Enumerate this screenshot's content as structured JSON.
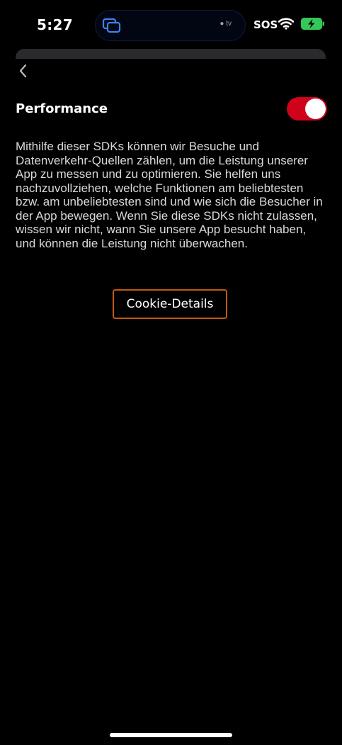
{
  "status_bar": {
    "time": "5:27",
    "island_label": "tv",
    "carrier": "SOS",
    "battery_color": "#34c759"
  },
  "header": {
    "back_icon": "chevron-left-icon"
  },
  "section": {
    "title": "Performance",
    "toggle_on": true,
    "toggle_color": "#d0021b",
    "description": "Mithilfe dieser SDKs können wir Besuche und Datenverkehr-Quellen zählen, um die Leistung unserer App zu messen und zu optimieren. Sie helfen uns nachzuvollziehen, welche Funktionen am beliebtesten bzw. am unbeliebtesten sind und wie sich die Besucher in der App bewegen. Wenn Sie diese SDKs nicht zulassen, wissen wir nicht, wann Sie unsere App besucht haben, und können die Leistung nicht überwachen."
  },
  "cookie_button": {
    "label": "Cookie-Details",
    "border_color": "#c25a10"
  }
}
